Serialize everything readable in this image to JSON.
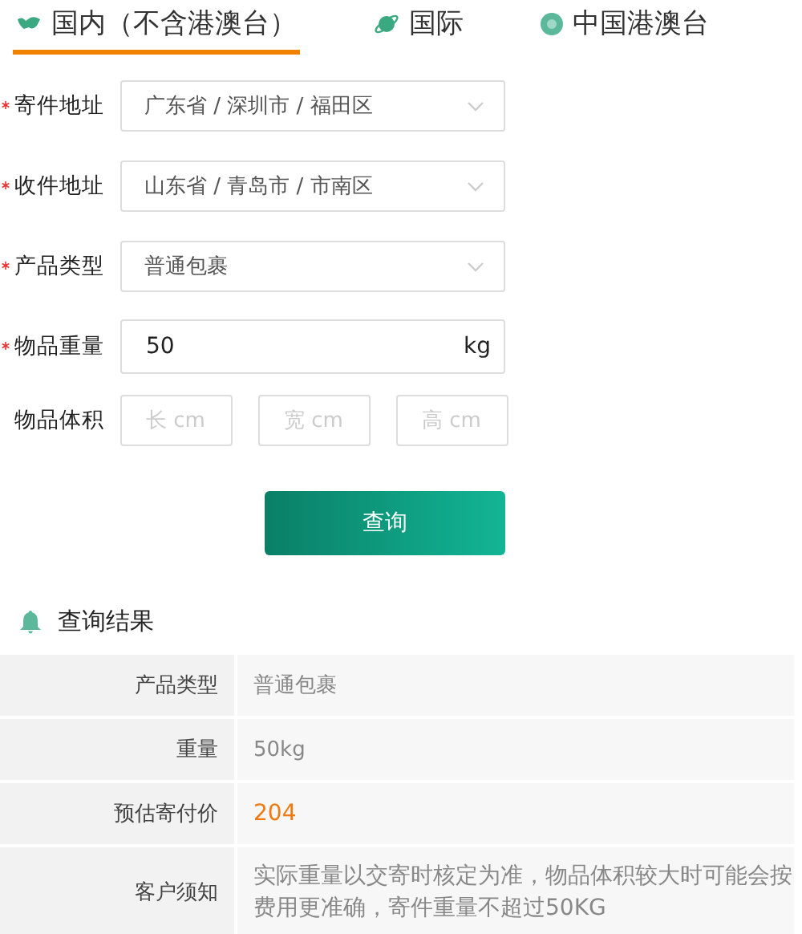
{
  "tabs": [
    {
      "label": "国内（不含港澳台）",
      "selected": true
    },
    {
      "label": "国际",
      "selected": false
    },
    {
      "label": "中国港澳台",
      "selected": false
    }
  ],
  "form": [
    {
      "kind": "select",
      "label": "寄件地址",
      "required": true,
      "value": "广东省 / 深圳市 / 福田区"
    },
    {
      "kind": "select",
      "label": "收件地址",
      "required": true,
      "value": "山东省 / 青岛市 / 市南区"
    },
    {
      "kind": "select",
      "label": "产品类型",
      "required": true,
      "value": "普通包裹"
    },
    {
      "kind": "unit",
      "label": "物品重量",
      "required": true,
      "value": "50",
      "unit": "kg"
    },
    {
      "kind": "dimensions",
      "label": "物品体积",
      "required": false,
      "placeholders": [
        "长 cm",
        "宽 cm",
        "高 cm"
      ]
    }
  ],
  "query_button": "查询",
  "results": {
    "title": "查询结果",
    "rows": [
      {
        "label": "产品类型",
        "value": [
          "普通包裹"
        ],
        "highlight": false
      },
      {
        "label": "重量",
        "value": [
          "50kg"
        ],
        "highlight": false
      },
      {
        "label": "预估寄付价",
        "value": [
          "204"
        ],
        "highlight": true
      },
      {
        "label": "客户须知",
        "value": [
          "实际重量以交寄时核定为准，物品体积较大时可能会按",
          "费用更准确，寄件重量不超过50KG"
        ],
        "highlight": false
      }
    ]
  }
}
